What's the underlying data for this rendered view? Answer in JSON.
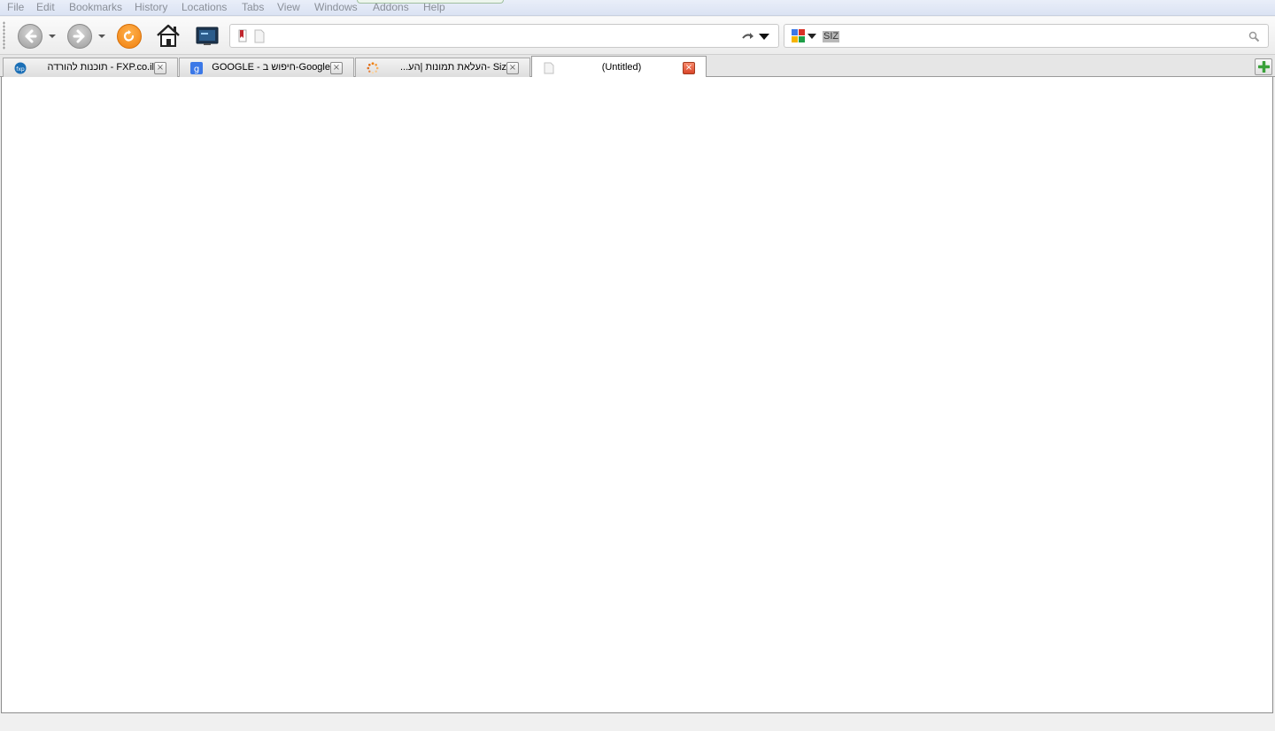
{
  "menu": {
    "items": [
      "File",
      "Edit",
      "Bookmarks",
      "History",
      "Locations",
      "Tabs",
      "View",
      "Windows",
      "Addons",
      "Help"
    ]
  },
  "address_bar": {
    "value": ""
  },
  "search_bar": {
    "engine": "google-icon",
    "query": "SIZ"
  },
  "tabs": [
    {
      "title": "FXP.co.il - תוכנות להורדה",
      "favicon": "fxp-icon",
      "active": false
    },
    {
      "title": "Google-חיפוש ב - GOOGLE",
      "favicon": "google-icon",
      "active": false
    },
    {
      "title": "Siz -העלאת תמונות |הע...",
      "favicon": "spinner-icon",
      "active": false
    },
    {
      "title": "(Untitled)",
      "favicon": "page-icon",
      "active": true
    }
  ],
  "colors": {
    "accent_orange": "#f07f0e",
    "close_active": "#d9462a",
    "new_tab_plus": "#3aa13a"
  }
}
